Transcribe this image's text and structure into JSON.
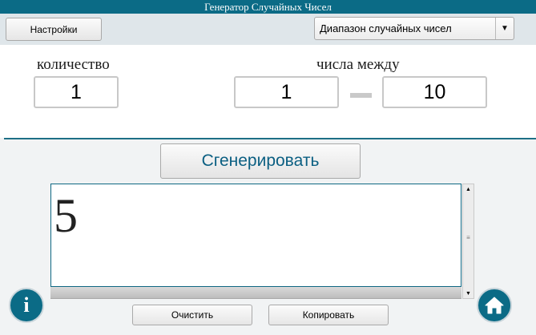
{
  "window": {
    "title": "Генератор Случайных Чисел"
  },
  "toolbar": {
    "settings_label": "Настройки",
    "mode_select": {
      "value": "Диапазон случайных чисел",
      "icon": "dropdown-arrow-icon"
    }
  },
  "form": {
    "count_label": "количество",
    "count_value": "1",
    "range_label": "числа между",
    "range_min": "1",
    "range_max": "10"
  },
  "generate_label": "Сгенерировать",
  "result": {
    "value": "5"
  },
  "actions": {
    "clear_label": "Очистить",
    "copy_label": "Копировать"
  },
  "colors": {
    "accent": "#0b6b86",
    "button_text": "#0b5f82"
  },
  "icons": {
    "info": "info-icon",
    "home": "home-icon"
  }
}
